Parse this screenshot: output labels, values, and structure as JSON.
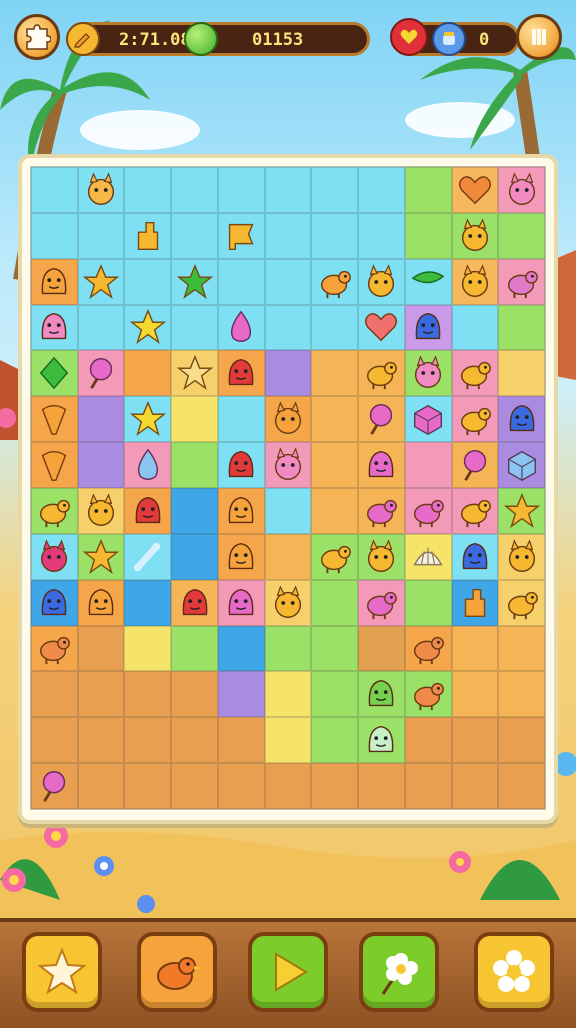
{
  "hud": {
    "timer": "2:71.08",
    "score": "01153",
    "coins": "0",
    "menu_icon": "puzzle-piece-icon",
    "pencil_icon": "pencil-icon",
    "gem_icon": "green-gem-icon",
    "heart_icon": "heart-badge-icon",
    "coin_icon": "coin-jar-icon",
    "pause_icon": "pause-icon"
  },
  "board": {
    "columns": 11,
    "rows": 14,
    "cell_colors": [
      [
        "#7ee0f2",
        "#7ee0f2",
        "#7ee0f2",
        "#7ee0f2",
        "#7ee0f2",
        "#7ee0f2",
        "#7ee0f2",
        "#7ee0f2",
        "#9be067",
        "#f6b85c",
        "#f39ab8"
      ],
      [
        "#7ee0f2",
        "#7ee0f2",
        "#7ee0f2",
        "#7ee0f2",
        "#7ee0f2",
        "#7ee0f2",
        "#7ee0f2",
        "#7ee0f2",
        "#9be067",
        "#9be067",
        "#9be067"
      ],
      [
        "#f5a64a",
        "#7ee0f2",
        "#7ee0f2",
        "#7ee0f2",
        "#7ee0f2",
        "#7ee0f2",
        "#7ee0f2",
        "#7ee0f2",
        "#7ee0f2",
        "#f6b85c",
        "#f39ab8"
      ],
      [
        "#7ee0f2",
        "#7ee0f2",
        "#7ee0f2",
        "#7ee0f2",
        "#7ee0f2",
        "#7ee0f2",
        "#7ee0f2",
        "#7ee0f2",
        "#c99be8",
        "#7ee0f2",
        "#9be067"
      ],
      [
        "#9be067",
        "#f39ab8",
        "#f5a64a",
        "#f6d06a",
        "#f5a64a",
        "#a98be0",
        "#f5b455",
        "#f5b455",
        "#9be067",
        "#f39ab8",
        "#f6d06a"
      ],
      [
        "#f5a64a",
        "#a98be0",
        "#7ee0f2",
        "#f6e36a",
        "#7ee0f2",
        "#f5a64a",
        "#f5b455",
        "#f5b455",
        "#7ee0f2",
        "#f39ab8",
        "#a98be0"
      ],
      [
        "#f5a64a",
        "#a98be0",
        "#f39ab8",
        "#9be067",
        "#7ee0f2",
        "#f39ab8",
        "#f5b455",
        "#f5b455",
        "#f39ab8",
        "#f5b455",
        "#a98be0"
      ],
      [
        "#9be067",
        "#f6d06a",
        "#f5a64a",
        "#3fa6e8",
        "#f5a64a",
        "#7ee0f2",
        "#f5b455",
        "#f5b455",
        "#f39ab8",
        "#f39ab8",
        "#9be067"
      ],
      [
        "#7ee0f2",
        "#9be067",
        "#7ee0f2",
        "#3fa6e8",
        "#f5a64a",
        "#f5b455",
        "#9be067",
        "#9be067",
        "#f6e36a",
        "#7ee0f2",
        "#f6d06a"
      ],
      [
        "#3fa6e8",
        "#f5a64a",
        "#3fa6e8",
        "#f5b455",
        "#f39ab8",
        "#f6d06a",
        "#9be067",
        "#f39ab8",
        "#9be067",
        "#3fa6e8",
        "#f6d06a"
      ],
      [
        "#f5a64a",
        "#e8a050",
        "#f6e36a",
        "#9be067",
        "#3fa6e8",
        "#9be067",
        "#9be067",
        "#e0a050",
        "#f5a64a",
        "#f5b455",
        "#f5b455"
      ],
      [
        "#e8a050",
        "#e8a050",
        "#e8a050",
        "#e8a050",
        "#a98be0",
        "#f6e36a",
        "#9be067",
        "#9be067",
        "#9be067",
        "#f5b455",
        "#f5b455"
      ],
      [
        "#e8a050",
        "#e8a050",
        "#e8a050",
        "#e8a050",
        "#e8a050",
        "#f6e36a",
        "#9be067",
        "#9be067",
        "#e8a050",
        "#e8a050",
        "#e8a050"
      ],
      [
        "#e8a050",
        "#e8a050",
        "#e8a050",
        "#e8a050",
        "#e8a050",
        "#e8a050",
        "#e8a050",
        "#e8a050",
        "#e8a050",
        "#e8a050",
        "#e8a050"
      ]
    ],
    "pieces": [
      {
        "r": 0,
        "c": 1,
        "kind": "creature",
        "color": "#f7b84a",
        "name": "fox-creature-icon"
      },
      {
        "r": 0,
        "c": 9,
        "kind": "heart",
        "color": "#f08a3a",
        "name": "heart-piece-icon"
      },
      {
        "r": 0,
        "c": 10,
        "kind": "creature",
        "color": "#f08ac0",
        "name": "pink-pig-icon"
      },
      {
        "r": 1,
        "c": 2,
        "kind": "block",
        "color": "#f5b830",
        "name": "yellow-block-icon"
      },
      {
        "r": 1,
        "c": 4,
        "kind": "flag",
        "color": "#f5b830",
        "name": "yellow-flag-icon"
      },
      {
        "r": 1,
        "c": 9,
        "kind": "creature",
        "color": "#f5b830",
        "name": "cat-creature-icon"
      },
      {
        "r": 2,
        "c": 0,
        "kind": "blob",
        "color": "#f5a33a",
        "name": "orange-blob-icon"
      },
      {
        "r": 2,
        "c": 1,
        "kind": "star",
        "color": "#f5b830",
        "name": "star-creature-icon"
      },
      {
        "r": 2,
        "c": 3,
        "kind": "star",
        "color": "#3dbb3d",
        "name": "green-star-icon"
      },
      {
        "r": 2,
        "c": 6,
        "kind": "animal",
        "color": "#f5a33a",
        "name": "orange-bird-icon"
      },
      {
        "r": 2,
        "c": 7,
        "kind": "creature",
        "color": "#f5b830",
        "name": "yellow-bunny-icon"
      },
      {
        "r": 2,
        "c": 8,
        "kind": "leaf",
        "color": "#3dbb3d",
        "name": "leaf-icon"
      },
      {
        "r": 2,
        "c": 9,
        "kind": "creature",
        "color": "#f5b830",
        "name": "yellow-chick-icon"
      },
      {
        "r": 2,
        "c": 10,
        "kind": "animal",
        "color": "#e07ac8",
        "name": "pink-bird-icon"
      },
      {
        "r": 3,
        "c": 0,
        "kind": "blob",
        "color": "#f08ac0",
        "name": "pink-ghost-icon"
      },
      {
        "r": 3,
        "c": 2,
        "kind": "star",
        "color": "#f5d830",
        "name": "yellow-star-icon"
      },
      {
        "r": 3,
        "c": 4,
        "kind": "drop",
        "color": "#e86ac8",
        "name": "pink-drop-icon"
      },
      {
        "r": 3,
        "c": 7,
        "kind": "heart",
        "color": "#f07070",
        "name": "red-heart-icon"
      },
      {
        "r": 3,
        "c": 8,
        "kind": "blob",
        "color": "#3a6ae0",
        "name": "blue-blob-icon"
      },
      {
        "r": 4,
        "c": 0,
        "kind": "gem",
        "color": "#3dbb3d",
        "name": "green-gem-icon"
      },
      {
        "r": 4,
        "c": 1,
        "kind": "candy",
        "color": "#e86ac8",
        "name": "pink-lollipop-icon"
      },
      {
        "r": 4,
        "c": 3,
        "kind": "star",
        "color": "#f7dc8a",
        "name": "cream-star-icon"
      },
      {
        "r": 4,
        "c": 4,
        "kind": "blob",
        "color": "#e23a3a",
        "name": "red-blob-icon"
      },
      {
        "r": 4,
        "c": 7,
        "kind": "animal",
        "color": "#f5b830",
        "name": "yellow-pig-icon"
      },
      {
        "r": 4,
        "c": 8,
        "kind": "creature",
        "color": "#f08ac0",
        "name": "pink-creature-icon"
      },
      {
        "r": 4,
        "c": 9,
        "kind": "animal",
        "color": "#f5b830",
        "name": "yellow-monkey-icon"
      },
      {
        "r": 5,
        "c": 0,
        "kind": "cone",
        "color": "#f5a33a",
        "name": "icecream-icon"
      },
      {
        "r": 5,
        "c": 2,
        "kind": "star",
        "color": "#f5d830",
        "name": "yellow-star-icon"
      },
      {
        "r": 5,
        "c": 5,
        "kind": "creature",
        "color": "#f5a33a",
        "name": "orange-cat-icon"
      },
      {
        "r": 5,
        "c": 7,
        "kind": "candy",
        "color": "#e86ac8",
        "name": "pink-candy-icon"
      },
      {
        "r": 5,
        "c": 8,
        "kind": "cube",
        "color": "#e86ac8",
        "name": "pink-cube-icon"
      },
      {
        "r": 5,
        "c": 9,
        "kind": "animal",
        "color": "#f5b830",
        "name": "yellow-turtle-icon"
      },
      {
        "r": 5,
        "c": 10,
        "kind": "blob",
        "color": "#3a6ae0",
        "name": "blue-creature-icon"
      },
      {
        "r": 6,
        "c": 0,
        "kind": "cone",
        "color": "#f5a33a",
        "name": "icecream-icon"
      },
      {
        "r": 6,
        "c": 2,
        "kind": "drop",
        "color": "#8ac4f0",
        "name": "blue-drop-icon"
      },
      {
        "r": 6,
        "c": 4,
        "kind": "blob",
        "color": "#e23a3a",
        "name": "red-blob-icon"
      },
      {
        "r": 6,
        "c": 5,
        "kind": "creature",
        "color": "#f08ac0",
        "name": "pink-creature-icon"
      },
      {
        "r": 6,
        "c": 7,
        "kind": "blob",
        "color": "#e86ac8",
        "name": "pink-blob-icon"
      },
      {
        "r": 6,
        "c": 9,
        "kind": "candy",
        "color": "#e86ac8",
        "name": "pink-lollipop-icon"
      },
      {
        "r": 6,
        "c": 10,
        "kind": "cube",
        "color": "#8ac4f0",
        "name": "blue-cube-icon"
      },
      {
        "r": 7,
        "c": 0,
        "kind": "animal",
        "color": "#f5b830",
        "name": "yellow-lion-icon"
      },
      {
        "r": 7,
        "c": 1,
        "kind": "creature",
        "color": "#f5b830",
        "name": "yellow-cat-icon"
      },
      {
        "r": 7,
        "c": 2,
        "kind": "blob",
        "color": "#e23a3a",
        "name": "red-blob-icon"
      },
      {
        "r": 7,
        "c": 4,
        "kind": "blob",
        "color": "#f5a33a",
        "name": "orange-blob-icon"
      },
      {
        "r": 7,
        "c": 7,
        "kind": "animal",
        "color": "#e86ac8",
        "name": "pink-bird-icon"
      },
      {
        "r": 7,
        "c": 8,
        "kind": "animal",
        "color": "#e86ac8",
        "name": "pink-pig-icon"
      },
      {
        "r": 7,
        "c": 9,
        "kind": "animal",
        "color": "#f5b830",
        "name": "yellow-turtle-icon"
      },
      {
        "r": 7,
        "c": 10,
        "kind": "star",
        "color": "#f5b830",
        "name": "yellow-starfish-icon"
      },
      {
        "r": 8,
        "c": 0,
        "kind": "creature",
        "color": "#e23a7a",
        "name": "red-mushroom-icon"
      },
      {
        "r": 8,
        "c": 1,
        "kind": "star",
        "color": "#f5b830",
        "name": "yellow-starfish-icon"
      },
      {
        "r": 8,
        "c": 2,
        "kind": "bone",
        "color": "#d8f0ff",
        "name": "bone-icon"
      },
      {
        "r": 8,
        "c": 4,
        "kind": "blob",
        "color": "#f5a33a",
        "name": "orange-blob-icon"
      },
      {
        "r": 8,
        "c": 6,
        "kind": "animal",
        "color": "#f5b830",
        "name": "yellow-fish-icon"
      },
      {
        "r": 8,
        "c": 7,
        "kind": "creature",
        "color": "#f5b830",
        "name": "yellow-bunny-icon"
      },
      {
        "r": 8,
        "c": 8,
        "kind": "shell",
        "color": "#f5f0e0",
        "name": "shell-icon"
      },
      {
        "r": 8,
        "c": 9,
        "kind": "blob",
        "color": "#3a6ae0",
        "name": "blue-blob-icon"
      },
      {
        "r": 8,
        "c": 10,
        "kind": "creature",
        "color": "#f5b830",
        "name": "yellow-bird-icon"
      },
      {
        "r": 9,
        "c": 0,
        "kind": "blob",
        "color": "#3a6ae0",
        "name": "blue-creature-icon"
      },
      {
        "r": 9,
        "c": 1,
        "kind": "blob",
        "color": "#f5a33a",
        "name": "orange-blob-icon"
      },
      {
        "r": 9,
        "c": 3,
        "kind": "blob",
        "color": "#e23a3a",
        "name": "red-apple-icon"
      },
      {
        "r": 9,
        "c": 4,
        "kind": "blob",
        "color": "#e86ac8",
        "name": "pink-blob-icon"
      },
      {
        "r": 9,
        "c": 5,
        "kind": "creature",
        "color": "#f5b830",
        "name": "yellow-chick-icon"
      },
      {
        "r": 9,
        "c": 7,
        "kind": "animal",
        "color": "#e86ac8",
        "name": "pink-pig-icon"
      },
      {
        "r": 9,
        "c": 9,
        "kind": "block",
        "color": "#f5a33a",
        "name": "orange-block-icon"
      },
      {
        "r": 9,
        "c": 10,
        "kind": "animal",
        "color": "#f5b830",
        "name": "yellow-dog-icon"
      },
      {
        "r": 10,
        "c": 0,
        "kind": "animal",
        "color": "#f08a4a",
        "name": "orange-fish-icon"
      },
      {
        "r": 10,
        "c": 8,
        "kind": "animal",
        "color": "#f08a4a",
        "name": "orange-bird-icon"
      },
      {
        "r": 11,
        "c": 7,
        "kind": "blob",
        "color": "#78d050",
        "name": "green-slime-icon"
      },
      {
        "r": 11,
        "c": 8,
        "kind": "animal",
        "color": "#f08a4a",
        "name": "orange-fish-icon"
      },
      {
        "r": 12,
        "c": 7,
        "kind": "blob",
        "color": "#c8f0c8",
        "name": "mint-bubble-icon"
      },
      {
        "r": 13,
        "c": 0,
        "kind": "candy",
        "color": "#e86ac8",
        "name": "pink-mushroom-icon"
      }
    ]
  },
  "toolbar": {
    "buttons": [
      {
        "name": "star-button",
        "icon": "star-icon",
        "bg": "#f6c531"
      },
      {
        "name": "bird-button",
        "icon": "bird-icon",
        "bg": "#f5a33a"
      },
      {
        "name": "play-button",
        "icon": "play-icon",
        "bg": "#7ccc2a"
      },
      {
        "name": "flower-lollipop-button",
        "icon": "flower-lollipop-icon",
        "bg": "#7ccc2a"
      },
      {
        "name": "flower-button",
        "icon": "flower-icon",
        "bg": "#f6c531"
      }
    ]
  }
}
